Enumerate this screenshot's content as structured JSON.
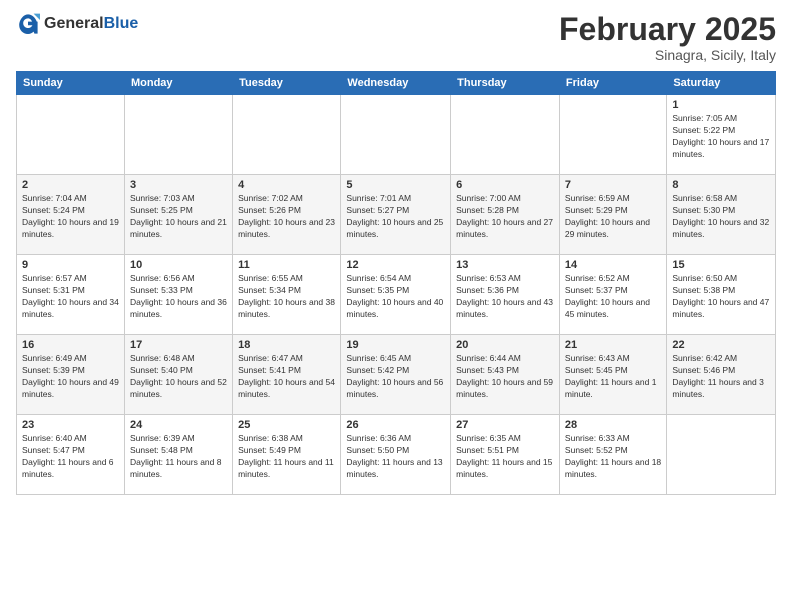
{
  "header": {
    "logo": {
      "general": "General",
      "blue": "Blue"
    },
    "title": "February 2025",
    "subtitle": "Sinagra, Sicily, Italy"
  },
  "calendar": {
    "days": [
      "Sunday",
      "Monday",
      "Tuesday",
      "Wednesday",
      "Thursday",
      "Friday",
      "Saturday"
    ],
    "weeks": [
      [
        {
          "day": "",
          "info": ""
        },
        {
          "day": "",
          "info": ""
        },
        {
          "day": "",
          "info": ""
        },
        {
          "day": "",
          "info": ""
        },
        {
          "day": "",
          "info": ""
        },
        {
          "day": "",
          "info": ""
        },
        {
          "day": "1",
          "info": "Sunrise: 7:05 AM\nSunset: 5:22 PM\nDaylight: 10 hours and 17 minutes."
        }
      ],
      [
        {
          "day": "2",
          "info": "Sunrise: 7:04 AM\nSunset: 5:24 PM\nDaylight: 10 hours and 19 minutes."
        },
        {
          "day": "3",
          "info": "Sunrise: 7:03 AM\nSunset: 5:25 PM\nDaylight: 10 hours and 21 minutes."
        },
        {
          "day": "4",
          "info": "Sunrise: 7:02 AM\nSunset: 5:26 PM\nDaylight: 10 hours and 23 minutes."
        },
        {
          "day": "5",
          "info": "Sunrise: 7:01 AM\nSunset: 5:27 PM\nDaylight: 10 hours and 25 minutes."
        },
        {
          "day": "6",
          "info": "Sunrise: 7:00 AM\nSunset: 5:28 PM\nDaylight: 10 hours and 27 minutes."
        },
        {
          "day": "7",
          "info": "Sunrise: 6:59 AM\nSunset: 5:29 PM\nDaylight: 10 hours and 29 minutes."
        },
        {
          "day": "8",
          "info": "Sunrise: 6:58 AM\nSunset: 5:30 PM\nDaylight: 10 hours and 32 minutes."
        }
      ],
      [
        {
          "day": "9",
          "info": "Sunrise: 6:57 AM\nSunset: 5:31 PM\nDaylight: 10 hours and 34 minutes."
        },
        {
          "day": "10",
          "info": "Sunrise: 6:56 AM\nSunset: 5:33 PM\nDaylight: 10 hours and 36 minutes."
        },
        {
          "day": "11",
          "info": "Sunrise: 6:55 AM\nSunset: 5:34 PM\nDaylight: 10 hours and 38 minutes."
        },
        {
          "day": "12",
          "info": "Sunrise: 6:54 AM\nSunset: 5:35 PM\nDaylight: 10 hours and 40 minutes."
        },
        {
          "day": "13",
          "info": "Sunrise: 6:53 AM\nSunset: 5:36 PM\nDaylight: 10 hours and 43 minutes."
        },
        {
          "day": "14",
          "info": "Sunrise: 6:52 AM\nSunset: 5:37 PM\nDaylight: 10 hours and 45 minutes."
        },
        {
          "day": "15",
          "info": "Sunrise: 6:50 AM\nSunset: 5:38 PM\nDaylight: 10 hours and 47 minutes."
        }
      ],
      [
        {
          "day": "16",
          "info": "Sunrise: 6:49 AM\nSunset: 5:39 PM\nDaylight: 10 hours and 49 minutes."
        },
        {
          "day": "17",
          "info": "Sunrise: 6:48 AM\nSunset: 5:40 PM\nDaylight: 10 hours and 52 minutes."
        },
        {
          "day": "18",
          "info": "Sunrise: 6:47 AM\nSunset: 5:41 PM\nDaylight: 10 hours and 54 minutes."
        },
        {
          "day": "19",
          "info": "Sunrise: 6:45 AM\nSunset: 5:42 PM\nDaylight: 10 hours and 56 minutes."
        },
        {
          "day": "20",
          "info": "Sunrise: 6:44 AM\nSunset: 5:43 PM\nDaylight: 10 hours and 59 minutes."
        },
        {
          "day": "21",
          "info": "Sunrise: 6:43 AM\nSunset: 5:45 PM\nDaylight: 11 hours and 1 minute."
        },
        {
          "day": "22",
          "info": "Sunrise: 6:42 AM\nSunset: 5:46 PM\nDaylight: 11 hours and 3 minutes."
        }
      ],
      [
        {
          "day": "23",
          "info": "Sunrise: 6:40 AM\nSunset: 5:47 PM\nDaylight: 11 hours and 6 minutes."
        },
        {
          "day": "24",
          "info": "Sunrise: 6:39 AM\nSunset: 5:48 PM\nDaylight: 11 hours and 8 minutes."
        },
        {
          "day": "25",
          "info": "Sunrise: 6:38 AM\nSunset: 5:49 PM\nDaylight: 11 hours and 11 minutes."
        },
        {
          "day": "26",
          "info": "Sunrise: 6:36 AM\nSunset: 5:50 PM\nDaylight: 11 hours and 13 minutes."
        },
        {
          "day": "27",
          "info": "Sunrise: 6:35 AM\nSunset: 5:51 PM\nDaylight: 11 hours and 15 minutes."
        },
        {
          "day": "28",
          "info": "Sunrise: 6:33 AM\nSunset: 5:52 PM\nDaylight: 11 hours and 18 minutes."
        },
        {
          "day": "",
          "info": ""
        }
      ]
    ]
  }
}
